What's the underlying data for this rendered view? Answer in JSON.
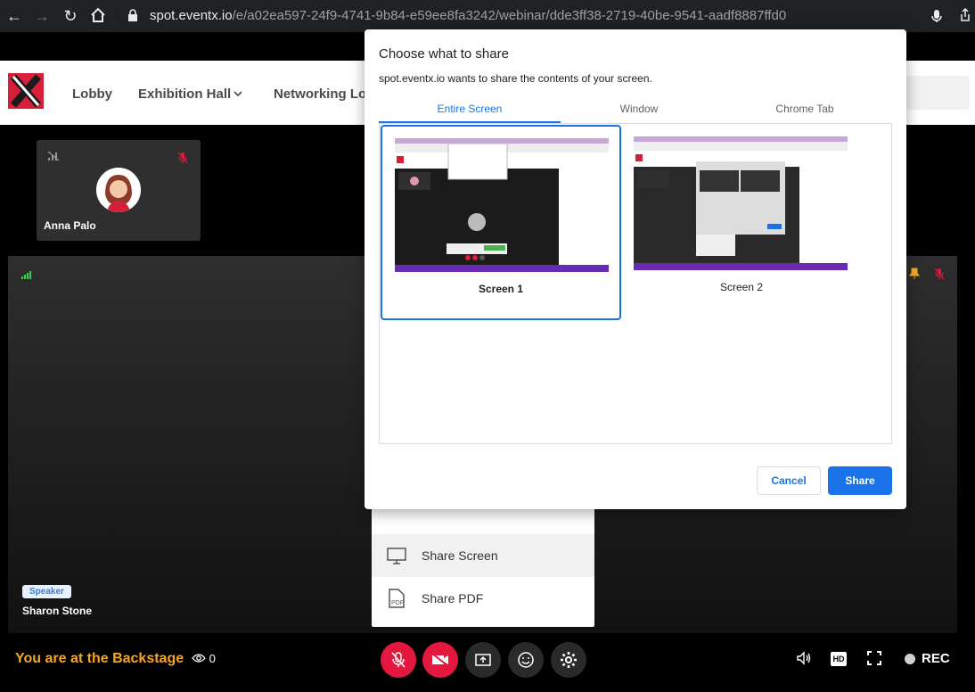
{
  "browser": {
    "url_host": "spot.eventx.io",
    "url_path": "/e/a02ea597-24f9-4741-9b84-e59ee8fa3242/webinar/dde3ff38-2719-40be-9541-aadf8887ffd0"
  },
  "header": {
    "nav": [
      "Lobby",
      "Exhibition Hall",
      "Networking Lou"
    ]
  },
  "stage": {
    "attendee_name": "Anna Palo",
    "speaker_badge": "Speaker",
    "speaker_name": "Sharon Stone"
  },
  "bottom_bar": {
    "backstage_label": "You are at the Backstage",
    "viewer_count": "0",
    "rec_label": "REC",
    "hd_label": "HD"
  },
  "share_menu": {
    "items": [
      "Share Screen",
      "Share PDF"
    ]
  },
  "dialog": {
    "title": "Choose what to share",
    "subtitle": "spot.eventx.io wants to share the contents of your screen.",
    "tabs": [
      "Entire Screen",
      "Window",
      "Chrome Tab"
    ],
    "active_tab": "Entire Screen",
    "screens": [
      "Screen 1",
      "Screen 2"
    ],
    "selected_screen": "Screen 1",
    "cancel_label": "Cancel",
    "share_label": "Share"
  },
  "colors": {
    "accent": "#1a73e8",
    "brand_red": "#e4173e",
    "backstage": "#f5a623"
  }
}
